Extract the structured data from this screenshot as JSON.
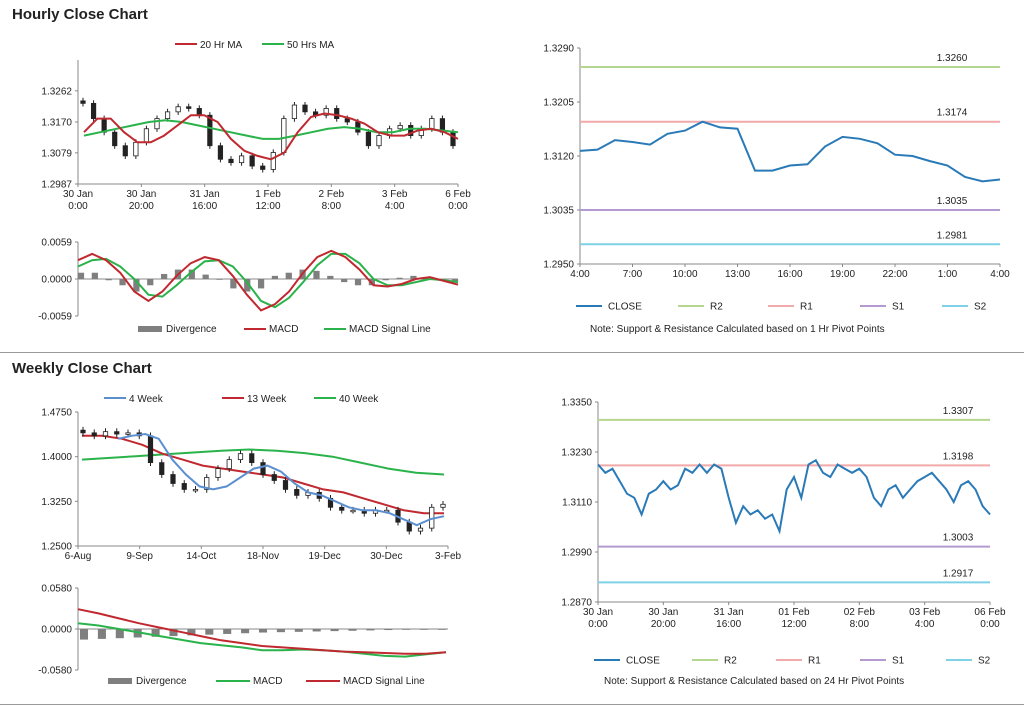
{
  "sections": {
    "hourly_title": "Hourly Close Chart",
    "weekly_title": "Weekly Close Chart"
  },
  "colors": {
    "ma_fast": "#c0292f",
    "ma_slow": "#2ab34a",
    "close_line": "#2a7ab8",
    "week4": "#5b8fd0",
    "r2": "#b5d68e",
    "r1": "#f2a9a9",
    "s1": "#b39ad0",
    "s2": "#7fd1e6",
    "divergence": "#7f7f7f"
  },
  "chart_data": [
    {
      "id": "hourly-price",
      "type": "candlestick",
      "title": "",
      "legend": [
        "20 Hr MA",
        "50 Hrs MA"
      ],
      "ylim": [
        1.2987,
        1.3353
      ],
      "y_ticks": [
        "1.3262",
        "1.3170",
        "1.3079",
        "1.2987"
      ],
      "x_ticks": [
        [
          "30 Jan",
          "0:00"
        ],
        [
          "30 Jan",
          "20:00"
        ],
        [
          "31 Jan",
          "16:00"
        ],
        [
          "1 Feb",
          "12:00"
        ],
        [
          "2 Feb",
          "8:00"
        ],
        [
          "3 Feb",
          "4:00"
        ],
        [
          "6 Feb",
          "0:00"
        ]
      ],
      "close": [
        1.3225,
        1.318,
        1.314,
        1.31,
        1.307,
        1.311,
        1.315,
        1.318,
        1.32,
        1.3215,
        1.321,
        1.319,
        1.31,
        1.306,
        1.305,
        1.307,
        1.304,
        1.303,
        1.308,
        1.318,
        1.322,
        1.32,
        1.319,
        1.321,
        1.318,
        1.317,
        1.314,
        1.31,
        1.313,
        1.315,
        1.316,
        1.313,
        1.315,
        1.318,
        1.314,
        1.31
      ],
      "ma20": [
        1.314,
        1.318,
        1.318,
        1.314,
        1.311,
        1.311,
        1.313,
        1.316,
        1.319,
        1.319,
        1.317,
        1.312,
        1.3085,
        1.307,
        1.306,
        1.308,
        1.314,
        1.3185,
        1.3195,
        1.319,
        1.318,
        1.3165,
        1.314,
        1.313,
        1.313,
        1.3145,
        1.315,
        1.314,
        1.312
      ],
      "ma50": [
        1.313,
        1.314,
        1.315,
        1.316,
        1.317,
        1.3175,
        1.317,
        1.316,
        1.315,
        1.314,
        1.313,
        1.312,
        1.312,
        1.313,
        1.314,
        1.315,
        1.3155,
        1.315,
        1.314,
        1.314,
        1.315,
        1.315,
        1.3145,
        1.314
      ]
    },
    {
      "id": "hourly-macd",
      "type": "line",
      "legend": [
        "Divergence",
        "MACD",
        "MACD Signal Line"
      ],
      "ylim": [
        -0.0059,
        0.0059
      ],
      "y_ticks": [
        "0.0059",
        "0.0000",
        "-0.0059"
      ],
      "macd": [
        0.003,
        0.004,
        0.003,
        0.001,
        -0.002,
        -0.0035,
        -0.002,
        0.0005,
        0.0025,
        0.0035,
        0.003,
        0.0005,
        -0.0025,
        -0.005,
        -0.004,
        -0.002,
        0.001,
        0.0035,
        0.0045,
        0.0035,
        0.0015,
        -0.001,
        -0.0012,
        -0.0008,
        0.0,
        0.0003,
        -0.0003,
        -0.0009
      ],
      "signal": [
        0.002,
        0.003,
        0.0032,
        0.002,
        0.0,
        -0.0025,
        -0.0028,
        -0.001,
        0.001,
        0.0028,
        0.003,
        0.002,
        -0.0005,
        -0.0035,
        -0.0045,
        -0.003,
        -0.0005,
        0.0022,
        0.004,
        0.004,
        0.0025,
        0.0,
        -0.001,
        -0.001,
        -0.0005,
        0.0,
        -0.0002,
        -0.0005
      ],
      "divergence": [
        0.001,
        0.001,
        -0.0002,
        -0.001,
        -0.002,
        -0.001,
        0.0008,
        0.0015,
        0.0015,
        0.0007,
        0.0,
        -0.0015,
        -0.002,
        -0.0015,
        0.0005,
        0.001,
        0.0015,
        0.0013,
        0.0005,
        -0.0005,
        -0.001,
        -0.001,
        -0.0002,
        0.0002,
        0.0005,
        0.0003,
        -0.0001,
        -0.0004
      ]
    },
    {
      "id": "hourly-pivot",
      "type": "line",
      "legend": [
        "CLOSE",
        "R2",
        "R1",
        "S1",
        "S2"
      ],
      "note": "Note: Support & Resistance Calculated based on 1 Hr Pivot Points",
      "ylim": [
        1.295,
        1.329
      ],
      "y_ticks": [
        "1.3290",
        "1.3205",
        "1.3120",
        "1.3035",
        "1.2950"
      ],
      "x_ticks": [
        "4:00",
        "7:00",
        "10:00",
        "13:00",
        "16:00",
        "19:00",
        "22:00",
        "1:00",
        "4:00"
      ],
      "levels": {
        "R2": 1.326,
        "R1": 1.3174,
        "S1": 1.3035,
        "S2": 1.2981
      },
      "level_labels": [
        "1.3260",
        "1.3174",
        "1.3035",
        "1.2981"
      ],
      "close": [
        1.3128,
        1.313,
        1.3145,
        1.3142,
        1.3138,
        1.3155,
        1.316,
        1.3174,
        1.3165,
        1.3163,
        1.3097,
        1.3097,
        1.3105,
        1.3107,
        1.3135,
        1.315,
        1.3147,
        1.314,
        1.3122,
        1.312,
        1.3112,
        1.3105,
        1.3087,
        1.308,
        1.3083
      ]
    },
    {
      "id": "weekly-price",
      "type": "candlestick",
      "legend": [
        "4 Week",
        "13 Week",
        "40 Week"
      ],
      "ylim": [
        1.25,
        1.475
      ],
      "y_ticks": [
        "1.4750",
        "1.4000",
        "1.3250",
        "1.2500"
      ],
      "x_ticks": [
        "6-Aug",
        "9-Sep",
        "14-Oct",
        "18-Nov",
        "19-Dec",
        "30-Dec",
        "3-Feb"
      ],
      "close": [
        1.44,
        1.435,
        1.442,
        1.438,
        1.44,
        1.435,
        1.39,
        1.37,
        1.355,
        1.345,
        1.345,
        1.365,
        1.38,
        1.395,
        1.405,
        1.39,
        1.37,
        1.36,
        1.345,
        1.335,
        1.34,
        1.33,
        1.315,
        1.31,
        1.31,
        1.305,
        1.31,
        1.31,
        1.29,
        1.275,
        1.28,
        1.315,
        1.32
      ],
      "ma4": [
        1.43,
        1.435,
        1.438,
        1.43,
        1.395,
        1.37,
        1.35,
        1.345,
        1.35,
        1.365,
        1.38,
        1.385,
        1.375,
        1.355,
        1.34,
        1.335,
        1.325,
        1.315,
        1.31,
        1.31,
        1.305,
        1.295,
        1.285,
        1.295,
        1.3
      ],
      "ma13": [
        1.435,
        1.435,
        1.43,
        1.42,
        1.405,
        1.395,
        1.385,
        1.38,
        1.375,
        1.37,
        1.365,
        1.355,
        1.345,
        1.34,
        1.33,
        1.32,
        1.31,
        1.305,
        1.305
      ],
      "ma40": [
        1.395,
        1.398,
        1.401,
        1.404,
        1.407,
        1.41,
        1.412,
        1.41,
        1.406,
        1.4,
        1.39,
        1.38,
        1.373,
        1.37
      ]
    },
    {
      "id": "weekly-macd",
      "type": "line",
      "legend": [
        "Divergence",
        "MACD",
        "MACD Signal Line"
      ],
      "ylim": [
        -0.058,
        0.058
      ],
      "y_ticks": [
        "0.0580",
        "0.0000",
        "-0.0580"
      ],
      "macd": [
        0.008,
        0.005,
        0.0,
        -0.005,
        -0.01,
        -0.015,
        -0.02,
        -0.023,
        -0.026,
        -0.03,
        -0.03,
        -0.029,
        -0.03,
        -0.032,
        -0.035,
        -0.038,
        -0.039,
        -0.036,
        -0.033
      ],
      "signal": [
        0.028,
        0.022,
        0.015,
        0.008,
        0.002,
        -0.004,
        -0.01,
        -0.016,
        -0.02,
        -0.024,
        -0.026,
        -0.028,
        -0.03,
        -0.032,
        -0.033,
        -0.034,
        -0.035,
        -0.035,
        -0.033
      ],
      "divergence": [
        -0.015,
        -0.014,
        -0.013,
        -0.012,
        -0.011,
        -0.01,
        -0.009,
        -0.008,
        -0.007,
        -0.006,
        -0.005,
        -0.0045,
        -0.004,
        -0.0035,
        -0.003,
        -0.0025,
        -0.002,
        -0.0015,
        -0.001,
        -0.0008,
        -0.0005
      ]
    },
    {
      "id": "weekly-pivot",
      "type": "line",
      "legend": [
        "CLOSE",
        "R2",
        "R1",
        "S1",
        "S2"
      ],
      "note": "Note: Support & Resistance Calculated based on 24 Hr Pivot Points",
      "ylim": [
        1.287,
        1.335
      ],
      "y_ticks": [
        "1.3350",
        "1.3230",
        "1.3110",
        "1.2990",
        "1.2870"
      ],
      "x_ticks": [
        [
          "30 Jan",
          "0:00"
        ],
        [
          "30 Jan",
          "20:00"
        ],
        [
          "31 Jan",
          "16:00"
        ],
        [
          "01 Feb",
          "12:00"
        ],
        [
          "02 Feb",
          "8:00"
        ],
        [
          "03 Feb",
          "4:00"
        ],
        [
          "06 Feb",
          "0:00"
        ]
      ],
      "levels": {
        "R2": 1.3307,
        "R1": 1.3198,
        "S1": 1.3003,
        "S2": 1.2917
      },
      "level_labels": [
        "1.3307",
        "1.3198",
        "1.3003",
        "1.2917"
      ],
      "close": [
        1.32,
        1.318,
        1.319,
        1.316,
        1.313,
        1.312,
        1.308,
        1.313,
        1.314,
        1.316,
        1.314,
        1.315,
        1.319,
        1.318,
        1.32,
        1.318,
        1.32,
        1.319,
        1.312,
        1.306,
        1.31,
        1.308,
        1.309,
        1.307,
        1.308,
        1.304,
        1.314,
        1.317,
        1.312,
        1.32,
        1.321,
        1.318,
        1.317,
        1.32,
        1.319,
        1.318,
        1.319,
        1.317,
        1.312,
        1.31,
        1.314,
        1.315,
        1.312,
        1.314,
        1.316,
        1.317,
        1.318,
        1.316,
        1.314,
        1.311,
        1.315,
        1.316,
        1.314,
        1.31,
        1.308
      ]
    }
  ]
}
